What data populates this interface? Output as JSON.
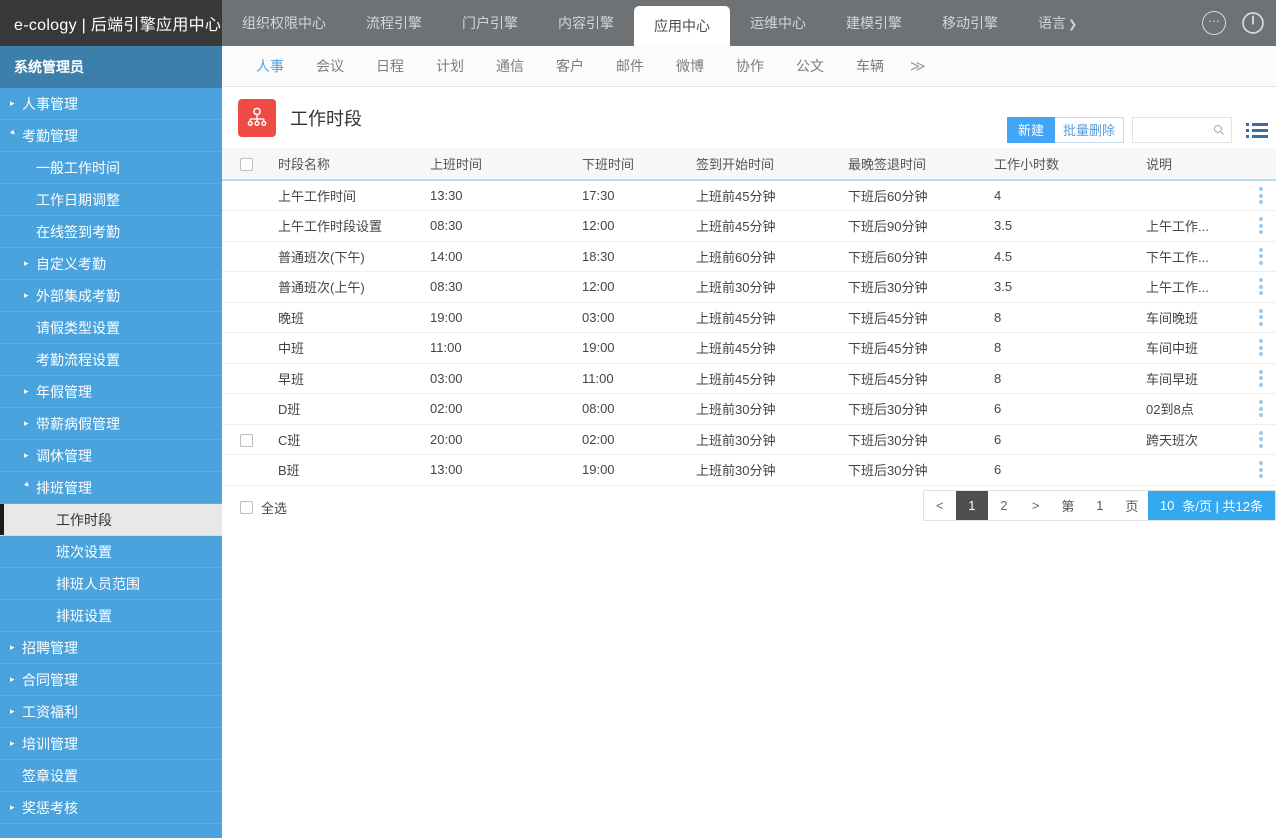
{
  "header": {
    "logo": "e-cology | 后端引擎应用中心",
    "engine_tabs": [
      {
        "label": "组织权限中心",
        "active": false
      },
      {
        "label": "流程引擎",
        "active": false
      },
      {
        "label": "门户引擎",
        "active": false
      },
      {
        "label": "内容引擎",
        "active": false
      },
      {
        "label": "应用中心",
        "active": true
      },
      {
        "label": "运维中心",
        "active": false
      },
      {
        "label": "建模引擎",
        "active": false
      },
      {
        "label": "移动引擎",
        "active": false
      },
      {
        "label": "语言",
        "active": false
      }
    ],
    "language_chevron": "❯",
    "more_icon": "⋯",
    "power_icon": "power-icon"
  },
  "subtabs": {
    "items": [
      {
        "label": "人事",
        "active": true
      },
      {
        "label": "会议",
        "active": false
      },
      {
        "label": "日程",
        "active": false
      },
      {
        "label": "计划",
        "active": false
      },
      {
        "label": "通信",
        "active": false
      },
      {
        "label": "客户",
        "active": false
      },
      {
        "label": "邮件",
        "active": false
      },
      {
        "label": "微博",
        "active": false
      },
      {
        "label": "协作",
        "active": false
      },
      {
        "label": "公文",
        "active": false
      },
      {
        "label": "车辆",
        "active": false
      }
    ],
    "more": "≫"
  },
  "sidebar": {
    "user": "系统管理员",
    "items": [
      {
        "label": "人事管理",
        "level": 1,
        "arrow": "collapsed",
        "selected": false
      },
      {
        "label": "考勤管理",
        "level": 1,
        "arrow": "expanded",
        "selected": false
      },
      {
        "label": "一般工作时间",
        "level": 2,
        "arrow": "none",
        "selected": false
      },
      {
        "label": "工作日期调整",
        "level": 2,
        "arrow": "none",
        "selected": false
      },
      {
        "label": "在线签到考勤",
        "level": 2,
        "arrow": "none",
        "selected": false
      },
      {
        "label": "自定义考勤",
        "level": 2,
        "arrow": "collapsed",
        "selected": false
      },
      {
        "label": "外部集成考勤",
        "level": 2,
        "arrow": "collapsed",
        "selected": false
      },
      {
        "label": "请假类型设置",
        "level": 2,
        "arrow": "none",
        "selected": false
      },
      {
        "label": "考勤流程设置",
        "level": 2,
        "arrow": "none",
        "selected": false
      },
      {
        "label": "年假管理",
        "level": 2,
        "arrow": "collapsed",
        "selected": false
      },
      {
        "label": "带薪病假管理",
        "level": 2,
        "arrow": "collapsed",
        "selected": false
      },
      {
        "label": "调休管理",
        "level": 2,
        "arrow": "collapsed",
        "selected": false
      },
      {
        "label": "排班管理",
        "level": 2,
        "arrow": "expanded",
        "selected": false
      },
      {
        "label": "工作时段",
        "level": 3,
        "arrow": "none",
        "selected": true
      },
      {
        "label": "班次设置",
        "level": 3,
        "arrow": "none",
        "selected": false
      },
      {
        "label": "排班人员范围",
        "level": 3,
        "arrow": "none",
        "selected": false
      },
      {
        "label": "排班设置",
        "level": 3,
        "arrow": "none",
        "selected": false
      },
      {
        "label": "招聘管理",
        "level": 1,
        "arrow": "collapsed",
        "selected": false
      },
      {
        "label": "合同管理",
        "level": 1,
        "arrow": "collapsed",
        "selected": false
      },
      {
        "label": "工资福利",
        "level": 1,
        "arrow": "collapsed",
        "selected": false
      },
      {
        "label": "培训管理",
        "level": 1,
        "arrow": "collapsed",
        "selected": false
      },
      {
        "label": "签章设置",
        "level": 1,
        "arrow": "none",
        "selected": false
      },
      {
        "label": "奖惩考核",
        "level": 1,
        "arrow": "collapsed",
        "selected": false
      }
    ]
  },
  "page": {
    "title": "工作时段",
    "icon": "org-chart-icon"
  },
  "toolbar": {
    "new_label": "新建",
    "batch_delete_label": "批量删除",
    "search_value": "",
    "search_placeholder": "",
    "search_icon": "search-icon",
    "list_view_icon": "list-view-icon"
  },
  "table": {
    "columns": [
      "时段名称",
      "上班时间",
      "下班时间",
      "签到开始时间",
      "最晚签退时间",
      "工作小时数",
      "说明"
    ],
    "header_checkbox_checked": false,
    "rows": [
      {
        "checkbox_visible": false,
        "checked": false,
        "name": "上午工作时间",
        "on": "13:30",
        "off": "17:30",
        "sign_in": "上班前45分钟",
        "sign_out": "下班后60分钟",
        "hours": "4",
        "desc": ""
      },
      {
        "checkbox_visible": false,
        "checked": false,
        "name": "上午工作时段设置",
        "on": "08:30",
        "off": "12:00",
        "sign_in": "上班前45分钟",
        "sign_out": "下班后90分钟",
        "hours": "3.5",
        "desc": "上午工作..."
      },
      {
        "checkbox_visible": false,
        "checked": false,
        "name": "普通班次(下午)",
        "on": "14:00",
        "off": "18:30",
        "sign_in": "上班前60分钟",
        "sign_out": "下班后60分钟",
        "hours": "4.5",
        "desc": "下午工作..."
      },
      {
        "checkbox_visible": false,
        "checked": false,
        "name": "普通班次(上午)",
        "on": "08:30",
        "off": "12:00",
        "sign_in": "上班前30分钟",
        "sign_out": "下班后30分钟",
        "hours": "3.5",
        "desc": "上午工作..."
      },
      {
        "checkbox_visible": false,
        "checked": false,
        "name": "晚班",
        "on": "19:00",
        "off": "03:00",
        "sign_in": "上班前45分钟",
        "sign_out": "下班后45分钟",
        "hours": "8",
        "desc": "车间晚班"
      },
      {
        "checkbox_visible": false,
        "checked": false,
        "name": "中班",
        "on": "11:00",
        "off": "19:00",
        "sign_in": "上班前45分钟",
        "sign_out": "下班后45分钟",
        "hours": "8",
        "desc": "车间中班"
      },
      {
        "checkbox_visible": false,
        "checked": false,
        "name": "早班",
        "on": "03:00",
        "off": "11:00",
        "sign_in": "上班前45分钟",
        "sign_out": "下班后45分钟",
        "hours": "8",
        "desc": "车间早班"
      },
      {
        "checkbox_visible": false,
        "checked": false,
        "name": "D班",
        "on": "02:00",
        "off": "08:00",
        "sign_in": "上班前30分钟",
        "sign_out": "下班后30分钟",
        "hours": "6",
        "desc": "02到8点"
      },
      {
        "checkbox_visible": true,
        "checked": false,
        "name": "C班",
        "on": "20:00",
        "off": "02:00",
        "sign_in": "上班前30分钟",
        "sign_out": "下班后30分钟",
        "hours": "6",
        "desc": "跨天班次"
      },
      {
        "checkbox_visible": false,
        "checked": false,
        "name": "B班",
        "on": "13:00",
        "off": "19:00",
        "sign_in": "上班前30分钟",
        "sign_out": "下班后30分钟",
        "hours": "6",
        "desc": ""
      }
    ],
    "row_action_icon": "more-vertical-icon"
  },
  "footer": {
    "select_all_label": "全选",
    "pager": {
      "prev": "<",
      "pages": [
        {
          "label": "1",
          "current": true
        },
        {
          "label": "2",
          "current": false
        }
      ],
      "next": ">",
      "jump_prefix": "第",
      "jump_value": "1",
      "jump_suffix": "页",
      "page_size": "10",
      "page_size_label": "条/页 | 共12条"
    }
  },
  "colors": {
    "sidebar": "#4ba3dd",
    "user_bar": "#3d7fab",
    "topbar": "#6e7274",
    "logo_bg": "#383838",
    "accent": "#42a5f5",
    "page_icon": "#ee4b44",
    "pager_sum": "#35a9ef"
  }
}
